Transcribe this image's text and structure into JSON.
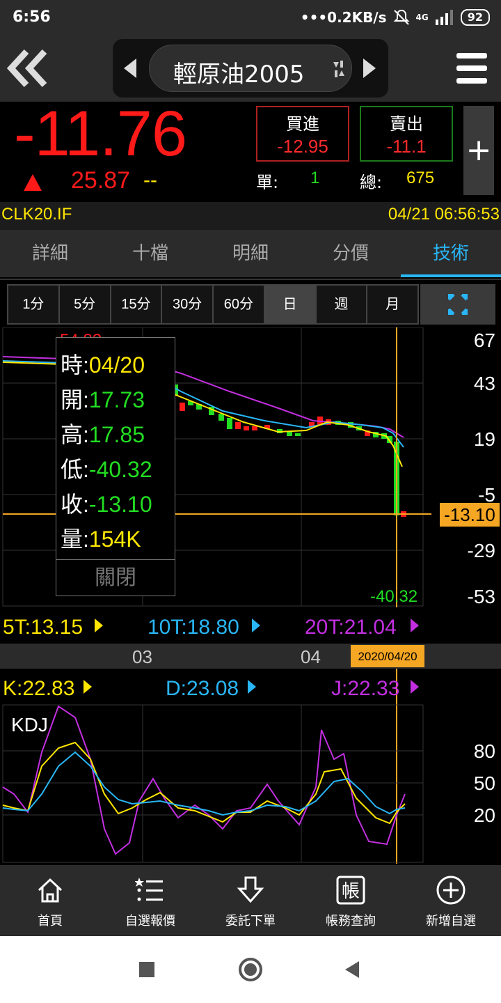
{
  "status_bar": {
    "time": "6:56",
    "speed": "•••0.2KB/s",
    "signal": "4G",
    "battery": "92"
  },
  "header": {
    "symbol": "輕原油2005"
  },
  "quote": {
    "price": "-11.76",
    "change": "25.87",
    "change_suffix": "--",
    "bid_label": "買進",
    "bid_value": "-12.95",
    "ask_label": "賣出",
    "ask_value": "-11.1",
    "unit_label": "單:",
    "unit_value": "1",
    "total_label": "總:",
    "total_value": "675",
    "plus": "+"
  },
  "code_row": {
    "code": "CLK20.IF",
    "datetime": "04/21 06:56:53"
  },
  "tabs": [
    "詳細",
    "十檔",
    "明細",
    "分價",
    "技術"
  ],
  "periods": [
    "1分",
    "5分",
    "15分",
    "30分",
    "60分",
    "日",
    "週",
    "月"
  ],
  "chart": {
    "price_axis": [
      "67",
      "43",
      "19",
      "-5",
      "-29",
      "-53"
    ],
    "current_price_tag": "-13.10",
    "high_label": "54.82",
    "low_label": "-40.32",
    "ma_5": "5T:13.15",
    "ma_10": "10T:18.80",
    "ma_20": "20T:21.04",
    "month_labels": [
      "03",
      "04"
    ],
    "cursor_date": "2020/04/20",
    "kdj_k": "K:22.83",
    "kdj_d": "D:23.08",
    "kdj_j": "J:22.33",
    "kdj_title": "KDJ",
    "kdj_axis": [
      "80",
      "50",
      "20"
    ]
  },
  "tooltip": {
    "time_label": "時:",
    "time_value": "04/20",
    "open_label": "開:",
    "open_value": "17.73",
    "high_label": "高:",
    "high_value": "17.85",
    "low_label": "低:",
    "low_value": "-40.32",
    "close_label": "收:",
    "close_value": "-13.10",
    "vol_label": "量:",
    "vol_value": "154K",
    "close_button": "關閉"
  },
  "bottom_nav": [
    {
      "label": "首頁",
      "icon": "home-icon"
    },
    {
      "label": "自選報價",
      "icon": "list-icon"
    },
    {
      "label": "委託下單",
      "icon": "download-icon"
    },
    {
      "label": "帳務查詢",
      "icon": "account-icon"
    },
    {
      "label": "新增自選",
      "icon": "add-circle-icon"
    }
  ],
  "colors": {
    "up": "#ff1a1a",
    "down": "#22dd22",
    "accent": "#29b6f6",
    "yellow": "#ffe600",
    "ma20": "#c22fe0"
  }
}
